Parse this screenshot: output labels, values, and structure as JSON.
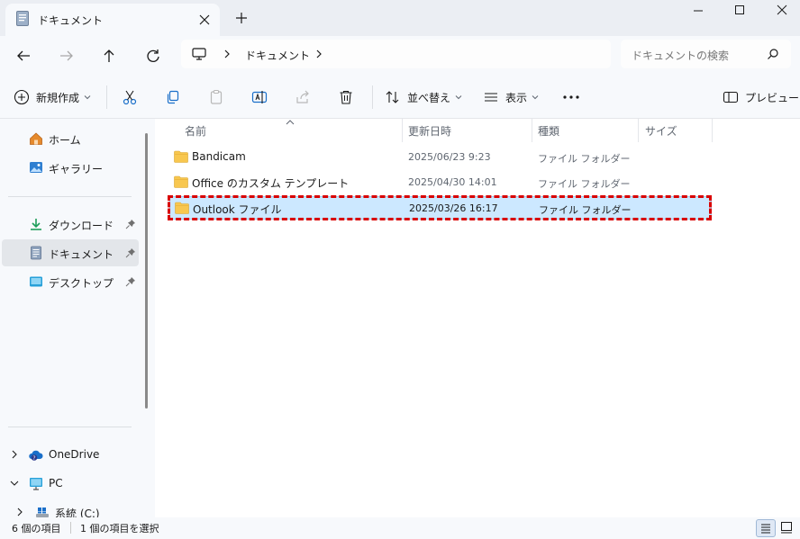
{
  "window": {
    "tab_title": "ドキュメント",
    "icons": {
      "tab": "document-icon",
      "close_tab": "close-icon",
      "new_tab": "plus-icon",
      "minimize": "minimize-icon",
      "maximize": "maximize-icon",
      "close": "close-icon"
    }
  },
  "navigation": {
    "address_segment": "ドキュメント",
    "search_placeholder": "ドキュメントの検索"
  },
  "commands": {
    "new": "新規作成",
    "sort": "並べ替え",
    "view": "表示",
    "preview": "プレビュー"
  },
  "sidebar": {
    "quick_access": [
      {
        "label": "ホーム",
        "icon": "home-icon",
        "pinned": false
      },
      {
        "label": "ギャラリー",
        "icon": "gallery-icon",
        "pinned": false
      }
    ],
    "pinned": [
      {
        "label": "ダウンロード",
        "icon": "download-icon",
        "pinned": true
      },
      {
        "label": "ドキュメント",
        "icon": "document-icon",
        "pinned": true,
        "selected": true
      },
      {
        "label": "デスクトップ",
        "icon": "desktop-icon",
        "pinned": true
      }
    ],
    "tree": [
      {
        "label": "OneDrive",
        "icon": "onedrive-icon",
        "expander": "collapsed"
      },
      {
        "label": "PC",
        "icon": "pc-icon",
        "expander": "expanded"
      },
      {
        "label": "系統 (C:)",
        "icon": "drive-icon",
        "expander": "collapsed"
      }
    ]
  },
  "columns": {
    "name": "名前",
    "modified": "更新日時",
    "type": "種類",
    "size": "サイズ"
  },
  "files": [
    {
      "name": "Bandicam",
      "modified": "2025/06/23 9:23",
      "type": "ファイル フォルダー",
      "size": ""
    },
    {
      "name": "Office のカスタム テンプレート",
      "modified": "2025/04/30 14:01",
      "type": "ファイル フォルダー",
      "size": ""
    },
    {
      "name": "Outlook ファイル",
      "modified": "2025/03/26 16:17",
      "type": "ファイル フォルダー",
      "size": "",
      "selected": true
    }
  ],
  "status": {
    "item_count": "6 個の項目",
    "selection": "1 個の項目を選択"
  },
  "colors": {
    "selection_bg": "#cce8ff",
    "annotation_border": "#d90000",
    "folder": "#f8c74f"
  }
}
